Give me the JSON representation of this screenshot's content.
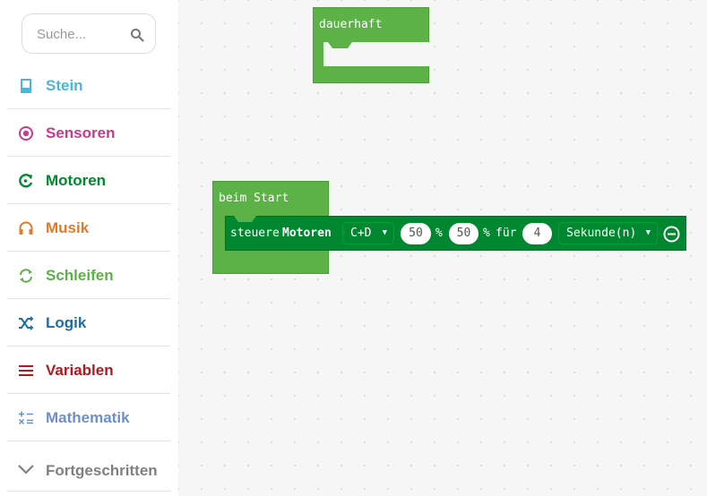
{
  "search": {
    "placeholder": "Suche..."
  },
  "categories": [
    {
      "label": "Stein",
      "color": "#4cb6d6",
      "icon": "brick-icon"
    },
    {
      "label": "Sensoren",
      "color": "#c53c8c",
      "icon": "sensor-icon"
    },
    {
      "label": "Motoren",
      "color": "#00872f",
      "icon": "motor-icon"
    },
    {
      "label": "Musik",
      "color": "#e07b2a",
      "icon": "headphones-icon"
    },
    {
      "label": "Schleifen",
      "color": "#5cb147",
      "icon": "loop-icon"
    },
    {
      "label": "Logik",
      "color": "#1f6e9f",
      "icon": "shuffle-icon"
    },
    {
      "label": "Variablen",
      "color": "#b0191f",
      "icon": "variables-icon"
    },
    {
      "label": "Mathematik",
      "color": "#6e8fc7",
      "icon": "math-icon"
    },
    {
      "label": "Fortgeschritten",
      "color": "#808080",
      "icon": "chevron-down-icon"
    }
  ],
  "workspace": {
    "forever_block": {
      "title": "dauerhaft",
      "color": "#5cb147"
    },
    "on_start_block": {
      "title": "beim Start",
      "color": "#5cb147"
    },
    "motor_block": {
      "prefix": "steuere",
      "keyword": "Motoren",
      "port": "C+D",
      "speed1": "50",
      "unit1": "%",
      "speed2": "50",
      "unit2": "%",
      "for_label": "für",
      "duration": "4",
      "time_unit": "Sekunde(n)",
      "color": "#00872f"
    }
  }
}
